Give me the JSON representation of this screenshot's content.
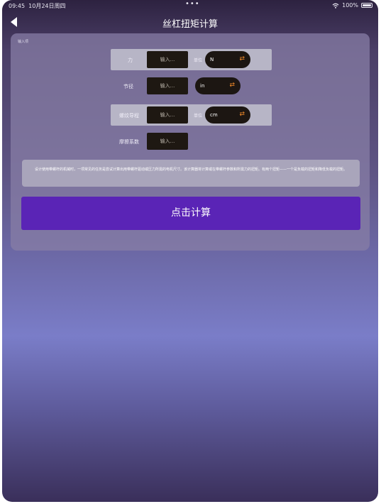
{
  "status": {
    "time": "09:45",
    "date": "10月24日周四",
    "dots": "•••",
    "battery": "100%"
  },
  "nav": {
    "title": "丝杠扭矩计算"
  },
  "form": {
    "section_label": "输入项",
    "force_label": "力",
    "force_placeholder": "输入...",
    "force_unit_label": "单位",
    "force_unit": "N",
    "pitch_label": "节径",
    "pitch_placeholder": "输入...",
    "pitch_unit": "in",
    "lead_label": "螺纹导程",
    "lead_placeholder": "输入...",
    "lead_unit_label": "单位",
    "lead_unit": "cm",
    "friction_label": "摩擦系数",
    "friction_placeholder": "输入..."
  },
  "info_text": "设计使用带螺杆的机械时，一项常见的任务是尝试计算出用带螺杆驱动或压力所需的电机尺寸。该计算器将计算或在带螺杆参数和所需力的扭矩。有两个扭矩——一个是负载的扭矩和降低负载的扭矩。",
  "calc_button": "点击计算"
}
